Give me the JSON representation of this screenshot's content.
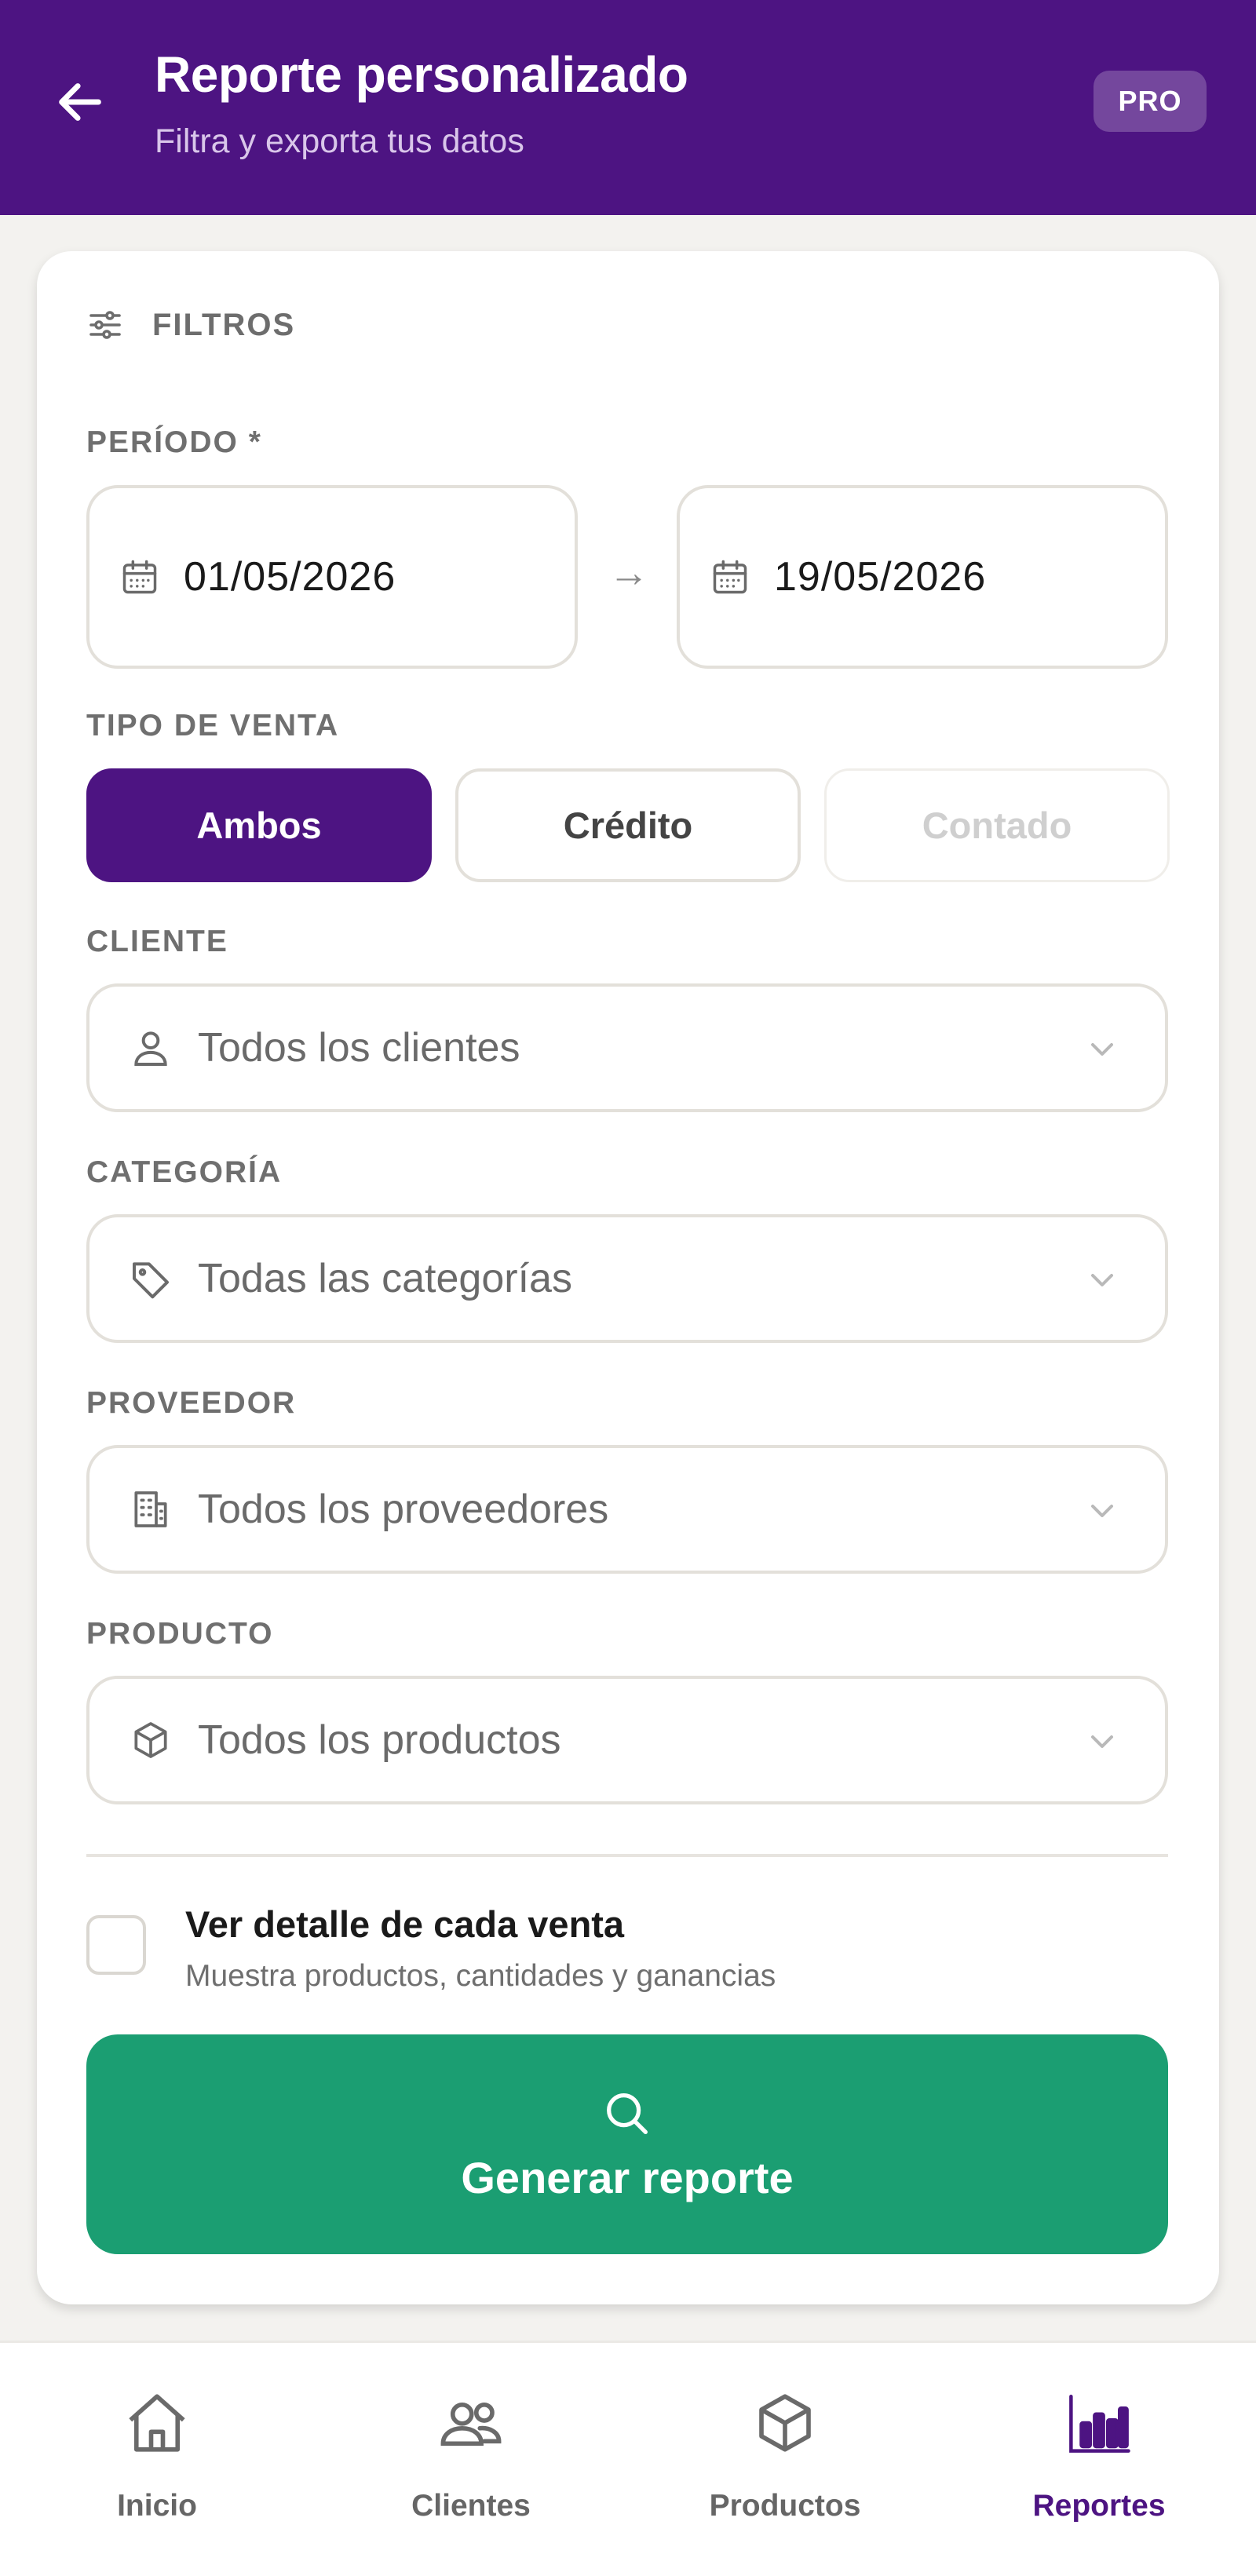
{
  "header": {
    "title": "Reporte personalizado",
    "subtitle": "Filtra y exporta tus datos",
    "badge": "PRO"
  },
  "filters": {
    "heading": "FILTROS",
    "period": {
      "label": "PERÍODO *",
      "from": "01/05/2026",
      "to": "19/05/2026",
      "separator": "→"
    },
    "sale_type": {
      "label": "TIPO DE VENTA",
      "options": [
        "Ambos",
        "Crédito",
        "Contado"
      ],
      "selected": "Ambos"
    },
    "client": {
      "label": "CLIENTE",
      "value": "Todos los clientes"
    },
    "category": {
      "label": "CATEGORÍA",
      "value": "Todas las categorías"
    },
    "supplier": {
      "label": "PROVEEDOR",
      "value": "Todos los proveedores"
    },
    "product": {
      "label": "PRODUCTO",
      "value": "Todos los productos"
    },
    "detail": {
      "title": "Ver detalle de cada venta",
      "subtitle": "Muestra productos, cantidades y ganancias",
      "checked": false
    },
    "generate_label": "Generar reporte"
  },
  "nav": {
    "items": [
      {
        "label": "Inicio",
        "icon": "home-icon"
      },
      {
        "label": "Clientes",
        "icon": "users-icon"
      },
      {
        "label": "Productos",
        "icon": "box-icon"
      },
      {
        "label": "Reportes",
        "icon": "bar-chart-icon"
      }
    ],
    "active": "Reportes"
  },
  "colors": {
    "brand": "#4d1482",
    "accent_green": "#1b9e72",
    "background": "#f3f2ef"
  }
}
